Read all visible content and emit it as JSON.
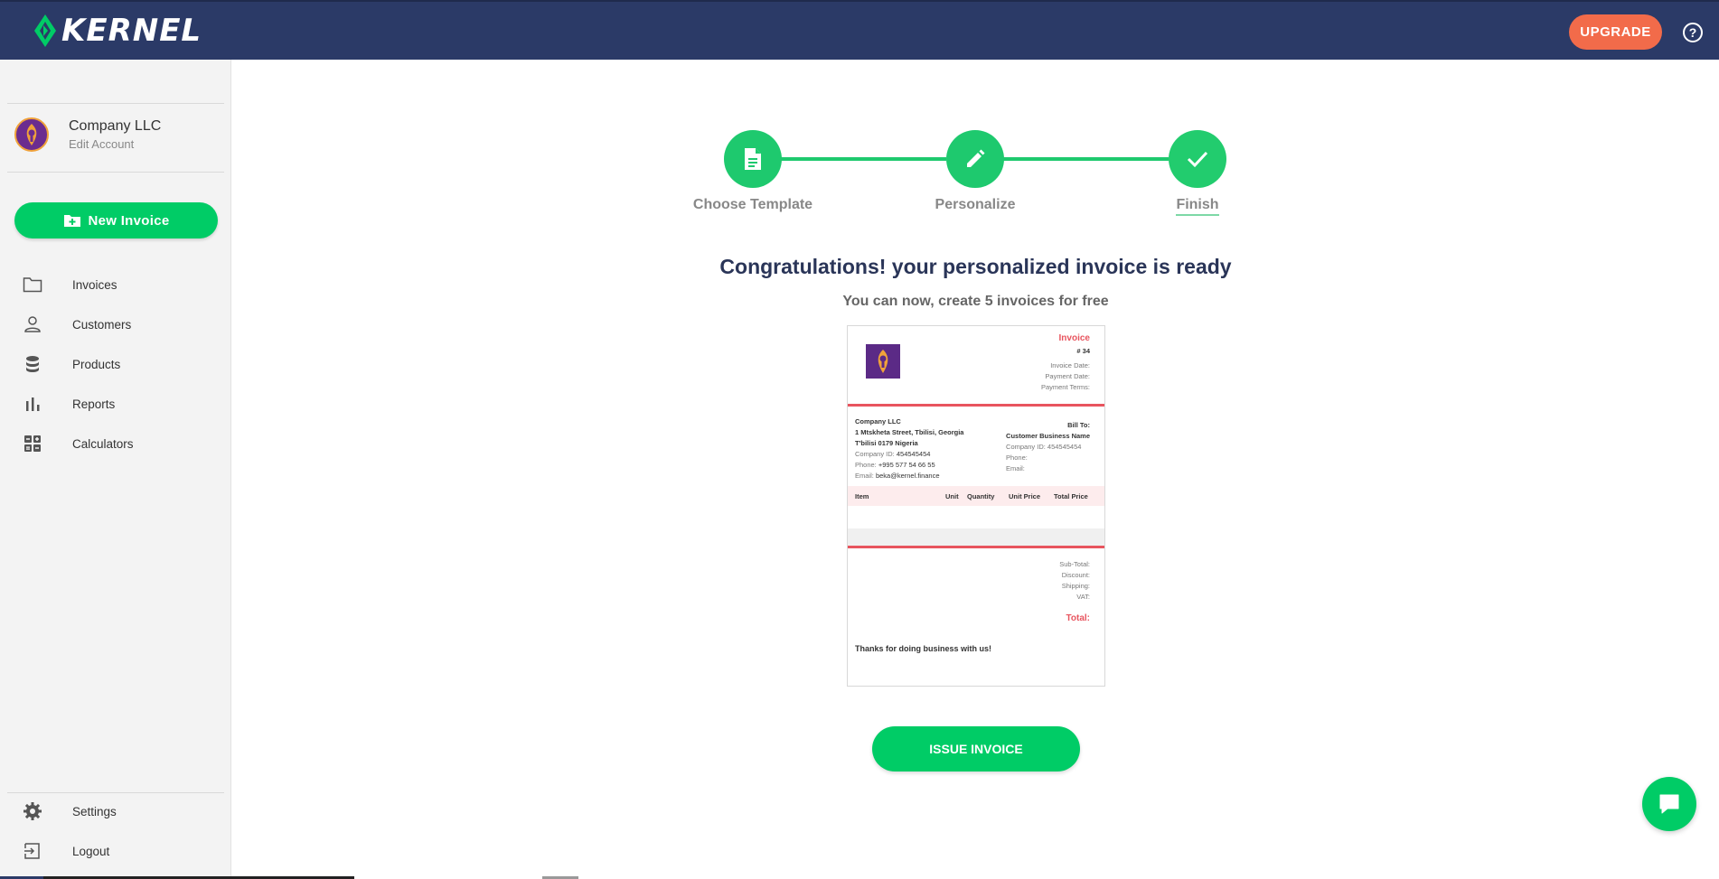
{
  "brand": {
    "name": "KERNEL",
    "accent": "#00cc66",
    "header_bg": "#2b3a67"
  },
  "header": {
    "upgrade_label": "UPGRADE",
    "help_icon": "help-circle-icon"
  },
  "account": {
    "name": "Company LLC",
    "edit_label": "Edit Account"
  },
  "sidebar": {
    "new_invoice_label": "New Invoice",
    "items": [
      {
        "label": "Invoices",
        "icon": "folder-icon"
      },
      {
        "label": "Customers",
        "icon": "user-icon"
      },
      {
        "label": "Products",
        "icon": "database-icon"
      },
      {
        "label": "Reports",
        "icon": "bar-chart-icon"
      },
      {
        "label": "Calculators",
        "icon": "calculator-icon"
      }
    ],
    "bottom_items": [
      {
        "label": "Settings",
        "icon": "gear-icon"
      },
      {
        "label": "Logout",
        "icon": "logout-icon"
      }
    ]
  },
  "steps": [
    {
      "label": "Choose Template",
      "icon": "document-icon"
    },
    {
      "label": "Personalize",
      "icon": "pencil-icon"
    },
    {
      "label": "Finish",
      "icon": "check-icon",
      "active": true
    }
  ],
  "main": {
    "title": "Congratulations! your personalized invoice is ready",
    "subtitle": "You can now, create 5 invoices for free",
    "issue_label": "ISSUE INVOICE"
  },
  "invoice": {
    "title": "Invoice",
    "number": "# 34",
    "invoice_date_label": "Invoice Date:",
    "payment_date_label": "Payment Date:",
    "payment_terms_label": "Payment Terms:",
    "from": {
      "name": "Company LLC",
      "address1": "1 Mtskheta Street, Tbilisi, Georgia",
      "address2": "T'bilisi 0179 Nigeria",
      "company_id_label": "Company ID:",
      "company_id": "454545454",
      "phone_label": "Phone:",
      "phone": "+995 577 54 66 55",
      "email_label": "Email:",
      "email": "beka@kernel.finance"
    },
    "to": {
      "label": "Bill To:",
      "name": "Customer Business Name",
      "company_id": "Company ID: 454545454",
      "phone": "Phone:",
      "email": "Email:"
    },
    "columns": {
      "item": "Item",
      "unit": "Unit",
      "quantity": "Quantity",
      "unit_price": "Unit Price",
      "total_price": "Total Price"
    },
    "totals": {
      "subtotal": "Sub-Total:",
      "discount": "Discount:",
      "shipping": "Shipping:",
      "vat": "VAT:",
      "total": "Total:"
    },
    "thanks": "Thanks for doing business with us!",
    "accent": "#e8545e"
  },
  "chat": {
    "icon": "chat-bubble-icon"
  }
}
